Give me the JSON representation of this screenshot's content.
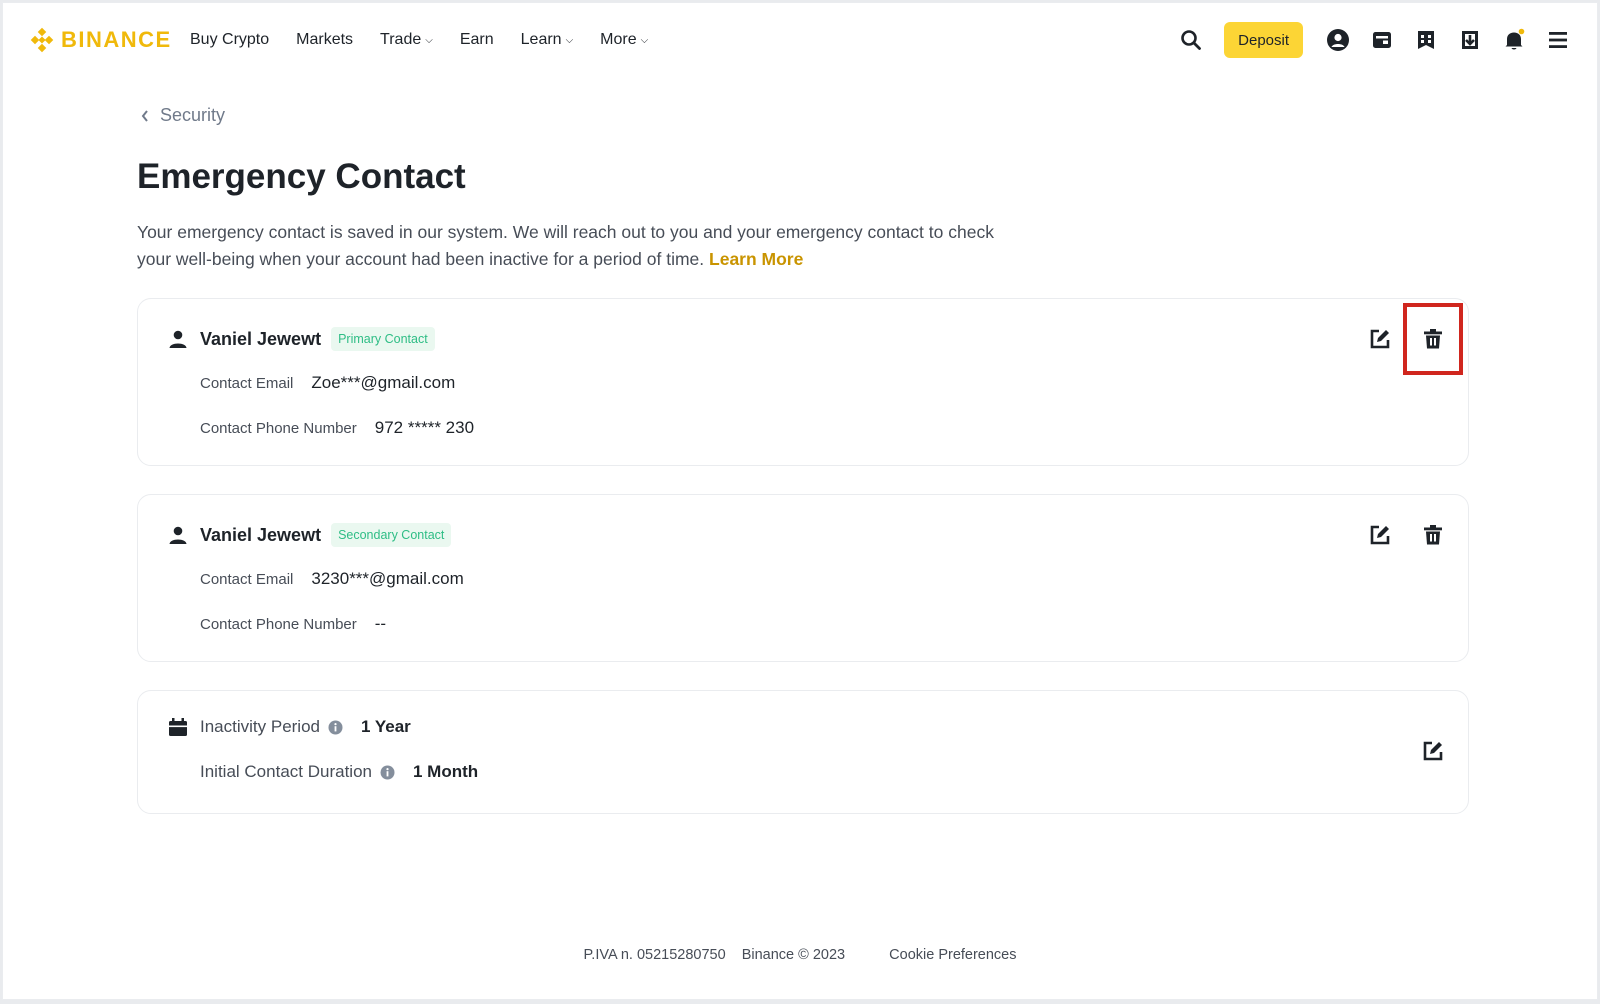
{
  "header": {
    "brand": "BINANCE",
    "nav": [
      {
        "label": "Buy Crypto",
        "dropdown": false
      },
      {
        "label": "Markets",
        "dropdown": false
      },
      {
        "label": "Trade",
        "dropdown": true
      },
      {
        "label": "Earn",
        "dropdown": false
      },
      {
        "label": "Learn",
        "dropdown": true
      },
      {
        "label": "More",
        "dropdown": true
      }
    ],
    "deposit_label": "Deposit",
    "icons": [
      "search-icon",
      "account-icon",
      "wallet-icon",
      "orders-icon",
      "download-icon",
      "bell-icon",
      "menu-icon"
    ]
  },
  "breadcrumb": {
    "label": "Security"
  },
  "page": {
    "title": "Emergency Contact",
    "description": "Your emergency contact is saved in our system. We will reach out to you and your emergency contact to check your well-being when your account had been inactive for a period of time.",
    "learn_more": "Learn More"
  },
  "contacts": [
    {
      "name": "Vaniel Jewewt",
      "badge": "Primary Contact",
      "email_label": "Contact Email",
      "email": "Zoe***@gmail.com",
      "phone_label": "Contact Phone Number",
      "phone": "972 ***** 230"
    },
    {
      "name": "Vaniel Jewewt",
      "badge": "Secondary Contact",
      "email_label": "Contact Email",
      "email": "3230***@gmail.com",
      "phone_label": "Contact Phone Number",
      "phone": "--"
    }
  ],
  "inactivity": {
    "period_label": "Inactivity Period",
    "period_value": "1 Year",
    "duration_label": "Initial Contact Duration",
    "duration_value": "1 Month"
  },
  "footer": {
    "piva": "P.IVA n. 05215280750",
    "copyright": "Binance © 2023",
    "cookie": "Cookie Preferences"
  },
  "colors": {
    "brand": "#f0b90b",
    "deposit": "#fcd535",
    "badge_bg": "#eaf8f0",
    "badge_text": "#2ebd85",
    "highlight": "#d0261e"
  }
}
